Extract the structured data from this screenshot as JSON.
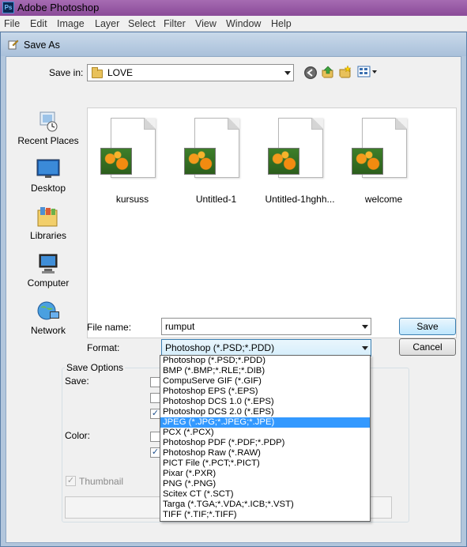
{
  "app": {
    "title": "Adobe Photoshop",
    "menu": [
      "File",
      "Edit",
      "Image",
      "Layer",
      "Select",
      "Filter",
      "View",
      "Window",
      "Help"
    ]
  },
  "dialog": {
    "title": "Save As",
    "save_in_label": "Save in:",
    "save_in_value": "LOVE"
  },
  "places": [
    {
      "label": "Recent Places",
      "icon": "recent-places-icon"
    },
    {
      "label": "Desktop",
      "icon": "desktop-icon"
    },
    {
      "label": "Libraries",
      "icon": "libraries-icon"
    },
    {
      "label": "Computer",
      "icon": "computer-icon"
    },
    {
      "label": "Network",
      "icon": "network-icon"
    }
  ],
  "files": [
    "kursuss",
    "Untitled-1",
    "Untitled-1hghh...",
    "welcome"
  ],
  "file_name": {
    "label": "File name:",
    "value": "rumput"
  },
  "format": {
    "label": "Format:",
    "value": "Photoshop (*.PSD;*.PDD)"
  },
  "buttons": {
    "save": "Save",
    "cancel": "Cancel"
  },
  "save_options": {
    "title": "Save Options",
    "save_label": "Save:",
    "color_label": "Color:",
    "thumbnail_label": "Thumbnail"
  },
  "format_options": [
    "Photoshop (*.PSD;*.PDD)",
    "BMP (*.BMP;*.RLE;*.DIB)",
    "CompuServe GIF (*.GIF)",
    "Photoshop EPS (*.EPS)",
    "Photoshop DCS 1.0 (*.EPS)",
    "Photoshop DCS 2.0 (*.EPS)",
    "JPEG (*.JPG;*.JPEG;*.JPE)",
    "PCX (*.PCX)",
    "Photoshop PDF (*.PDF;*.PDP)",
    "Photoshop Raw (*.RAW)",
    "PICT File (*.PCT;*.PICT)",
    "Pixar (*.PXR)",
    "PNG (*.PNG)",
    "Scitex CT (*.SCT)",
    "Targa (*.TGA;*.VDA;*.ICB;*.VST)",
    "TIFF (*.TIF;*.TIFF)"
  ],
  "selected_format_index": 6
}
